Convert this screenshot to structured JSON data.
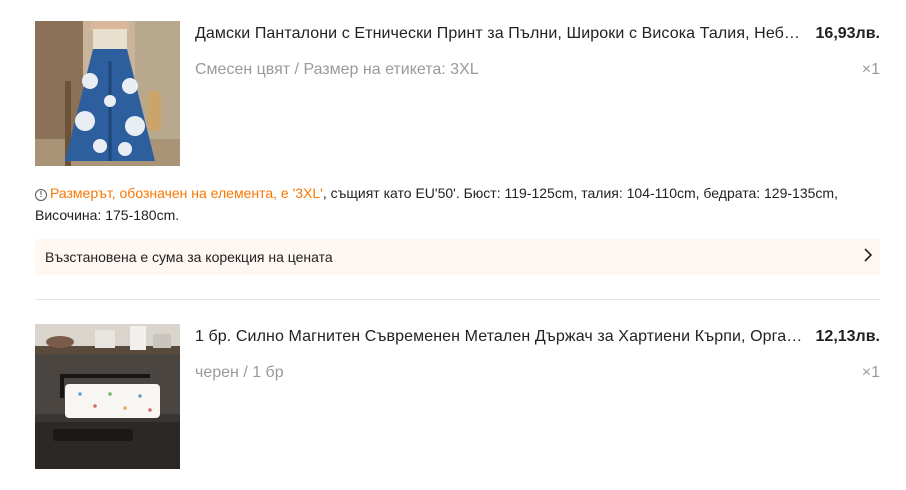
{
  "items": [
    {
      "title": "Дамски Панталони с Етнически Принт за Пълни, Широки с Висока Талия, Небрежни, Удобни",
      "price": "16,93лв.",
      "spec": "Смесен цвят / Размер на етикета: 3XL",
      "qty": "×1",
      "image_icon": "wide-leg-pants-photo"
    },
    {
      "title": "1 бр. Силно Магнитен Съвременен Метален Държач за Хартиени Кърпи, Органайзер за Кухня",
      "price": "12,13лв.",
      "spec": "черен / 1 бр",
      "qty": "×1",
      "image_icon": "paper-towel-holder-photo"
    }
  ],
  "size_note": {
    "icon": "warning-icon",
    "highlight": "Размерът, обозначен на елемента, е '3XL'",
    "rest": ", същият като EU'50'. Бюст: 119-125cm, талия: 104-110cm, бедрата: 129-135cm, Височина: 175-180cm."
  },
  "banner": {
    "text": "Възстановена е сума за корекция на цената",
    "icon": "chevron-right-icon"
  },
  "colors": {
    "accent": "#fb7701",
    "banner_bg": "#fff7f2",
    "muted": "#9a9a9a"
  }
}
